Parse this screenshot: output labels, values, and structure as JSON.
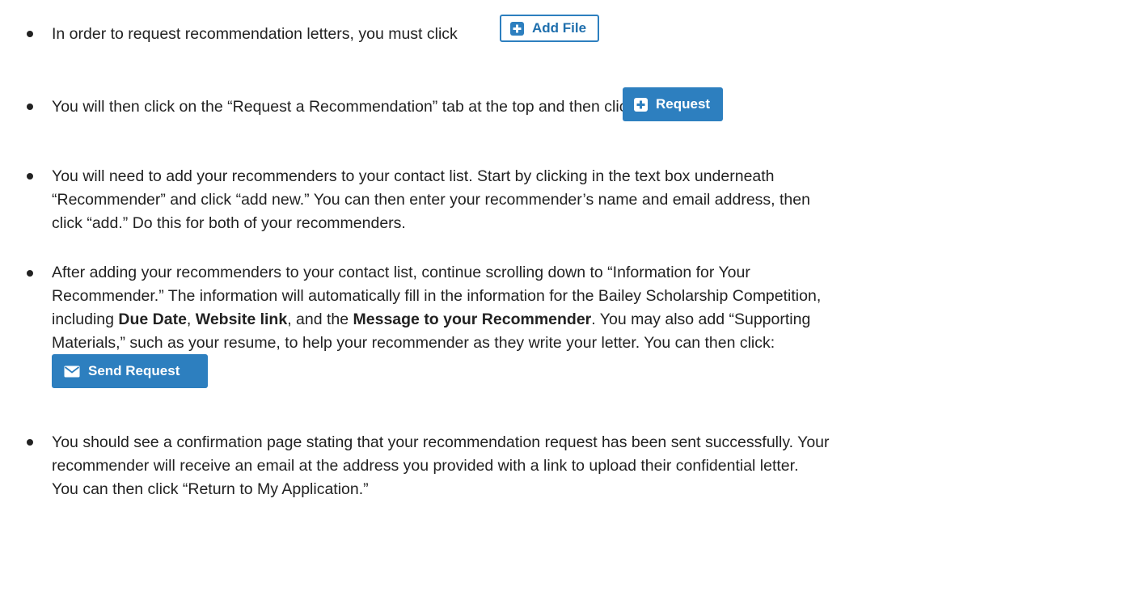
{
  "steps": {
    "step1": {
      "text": "In order to request recommendation letters, you must click",
      "button_label": "Add File",
      "button_icon": "plus-square-icon"
    },
    "step2": {
      "text": "You will then click on the “Request a Recommendation” tab at the top and then click",
      "button_label": "Request",
      "button_icon": "plus-square-icon"
    },
    "step3": {
      "line1": "You will need to add your recommenders to your contact list. Start by clicking in the text box underneath",
      "line2": "“Recommender” and click “add new.” You can then enter your recommender’s name and email address, then",
      "line3": "click “add.” Do this for both of your recommenders."
    },
    "step4": {
      "line1": "After adding your recommenders to your contact list, continue scrolling down to “Information for Your",
      "line2": "Recommender.” The information will automatically fill in the information for the Bailey Scholarship Competition,",
      "line3_a": "including ",
      "line3_due_date": "Due Date",
      "line3_b": ", ",
      "line3_website": "Website link",
      "line3_c": ", and the ",
      "line3_message": "Message to your Recommender",
      "line3_d": ". You may also add “Supporting",
      "line4": "Materials,” such as your resume, to help your recommender as they write your letter. You can then click:",
      "button_label": "Send Request",
      "button_icon": "envelope-icon"
    },
    "step5": {
      "line1": "You should see a confirmation page stating that your recommendation request has been sent successfully. Your",
      "line2": "recommender will receive an email at the address you provided with a link to upload their confidential letter.",
      "line3": "You can then click “Return to My Application.”"
    }
  },
  "colors": {
    "accent": "#2d7fbf",
    "text": "#222222"
  }
}
